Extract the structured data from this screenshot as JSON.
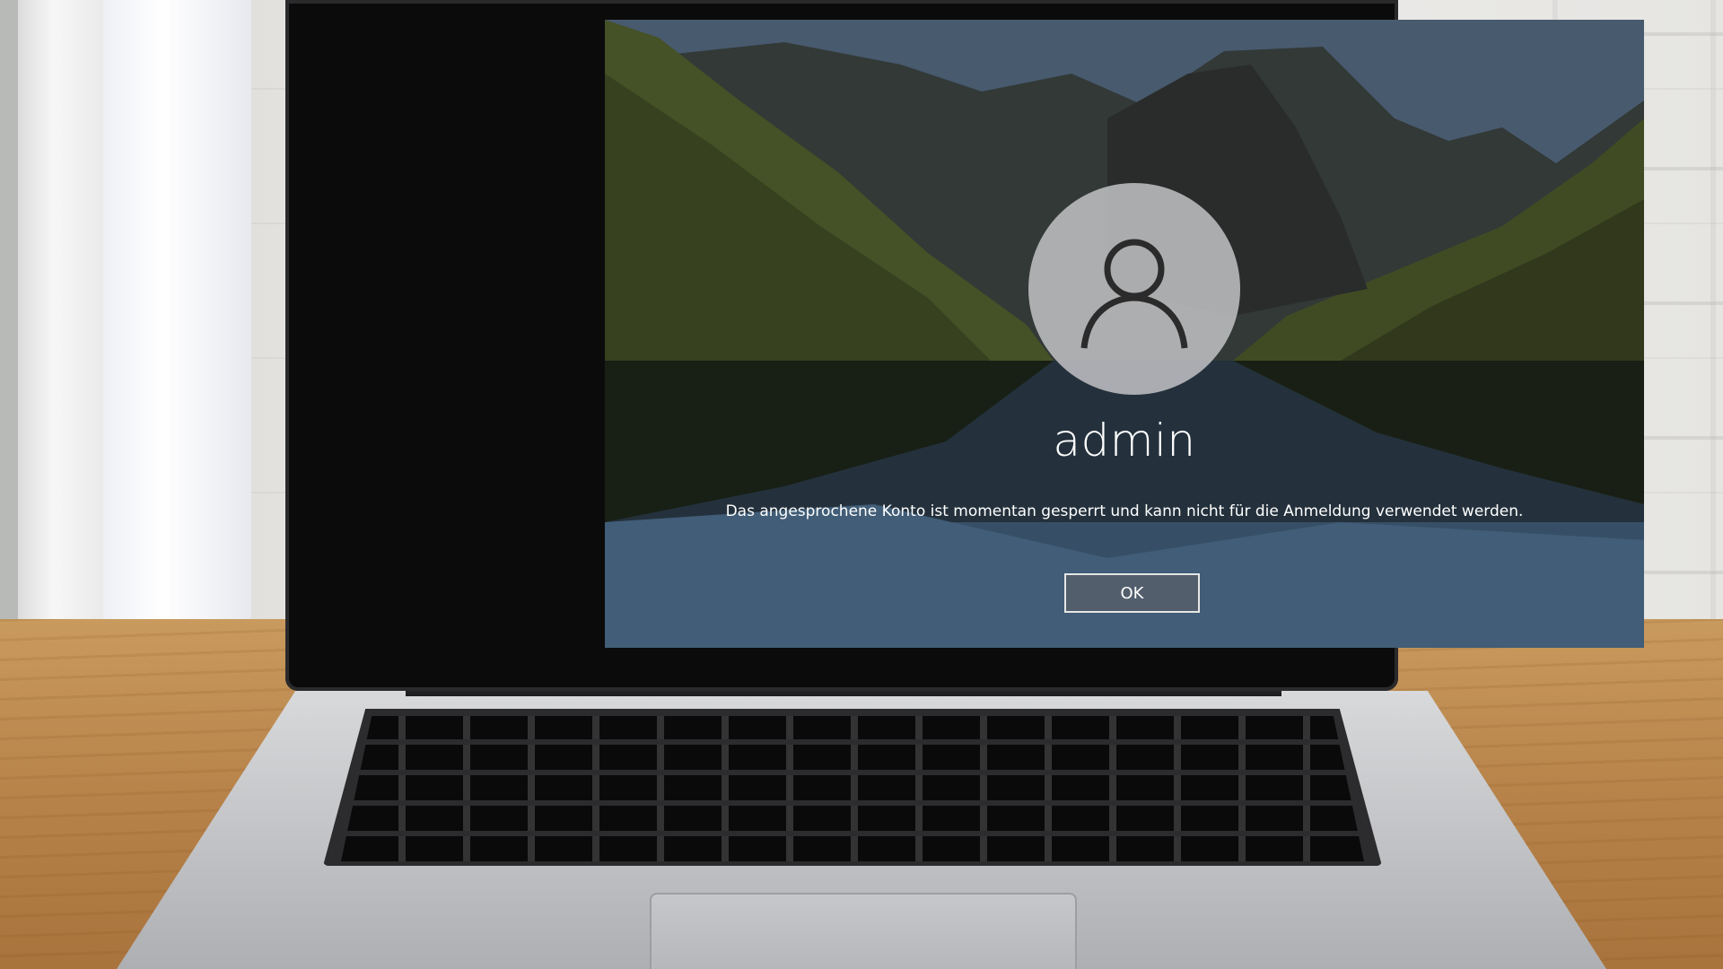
{
  "lock_screen": {
    "username": "admin",
    "message": "Das angesprochene Konto ist momentan gesperrt und kann nicht für die Anmeldung verwendet werden.",
    "ok_label": "OK",
    "avatar_icon": "user-icon"
  },
  "colors": {
    "text": "#ffffff",
    "avatar_bg": "#c8c8ca",
    "button_border": "#e6e6e6"
  }
}
